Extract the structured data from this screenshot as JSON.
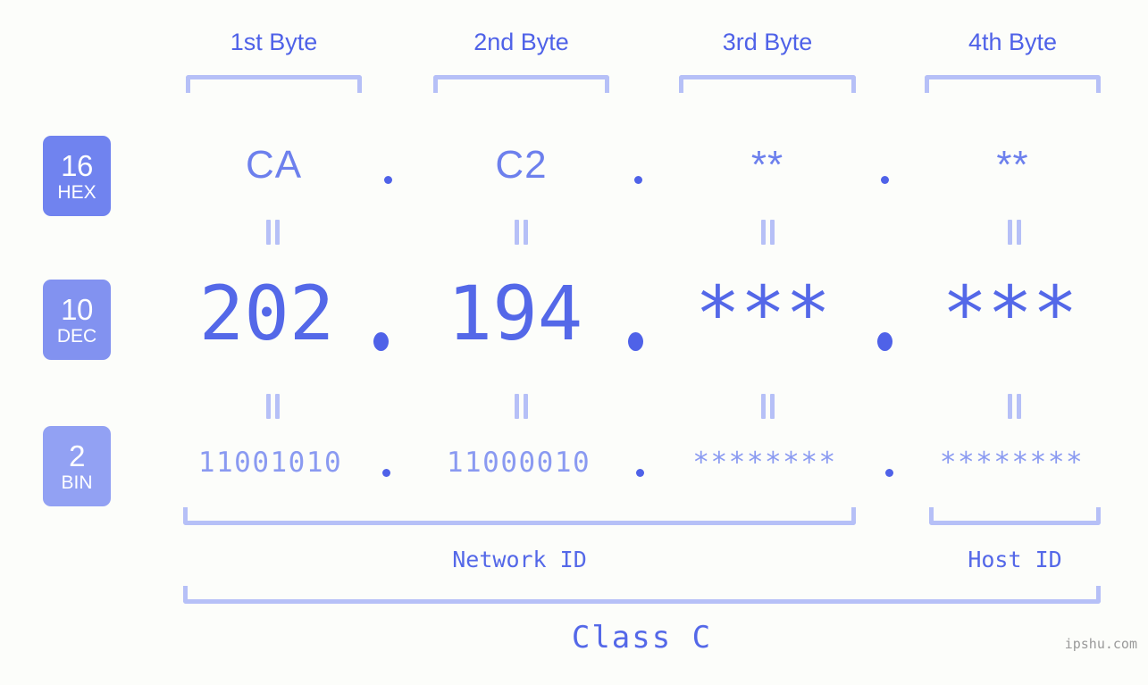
{
  "watermark": "ipshu.com",
  "colors": {
    "background": "#fcfdfa",
    "accent_strong": "#4f62e8",
    "accent_mid": "#6d80ed",
    "accent_light": "#8a9af1",
    "bracket": "#b6c0f7",
    "badge_hex": "#7083ef",
    "badge_dec": "#8292f0",
    "badge_bin": "#92a1f3",
    "watermark": "#9a9a9a"
  },
  "byte_headers": [
    {
      "label": "1st Byte"
    },
    {
      "label": "2nd Byte"
    },
    {
      "label": "3rd Byte"
    },
    {
      "label": "4th Byte"
    }
  ],
  "bases": [
    {
      "number": "16",
      "system": "HEX"
    },
    {
      "number": "10",
      "system": "DEC"
    },
    {
      "number": "2",
      "system": "BIN"
    }
  ],
  "rows": {
    "hex": {
      "values": [
        "CA",
        "C2",
        "**",
        "**"
      ]
    },
    "dec": {
      "values": [
        "202",
        "194",
        "***",
        "***"
      ]
    },
    "bin": {
      "values": [
        "11001010",
        "11000010",
        "********",
        "********"
      ]
    }
  },
  "separators": {
    "dot": "."
  },
  "equality": {
    "symbol": "="
  },
  "segments": {
    "network_id": "Network ID",
    "host_id": "Host ID",
    "class": "Class C"
  }
}
